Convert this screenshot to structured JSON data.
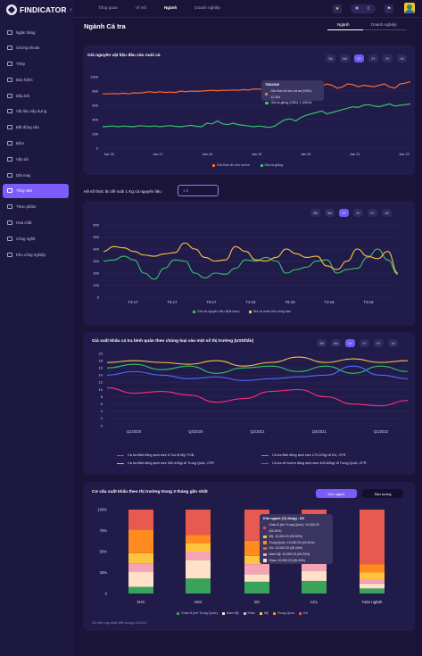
{
  "brand": {
    "name": "FINDICATOR"
  },
  "sidebar": {
    "items": [
      {
        "label": "Ngân hàng",
        "icon": "bank-icon"
      },
      {
        "label": "Chứng khoán",
        "icon": "stock-icon"
      },
      {
        "label": "Thép",
        "icon": "steel-icon"
      },
      {
        "label": "Bảo hiểm",
        "icon": "shield-icon"
      },
      {
        "label": "Dầu khí",
        "icon": "oil-icon"
      },
      {
        "label": "Vật liệu xây dựng",
        "icon": "tools-icon"
      },
      {
        "label": "Bất động sản",
        "icon": "building-icon"
      },
      {
        "label": "Điện",
        "icon": "electric-icon"
      },
      {
        "label": "Vận tải",
        "icon": "truck-icon"
      },
      {
        "label": "Dệt may",
        "icon": "textile-icon"
      },
      {
        "label": "Thủy sản",
        "icon": "fish-icon",
        "active": true
      },
      {
        "label": "Thực phẩm",
        "icon": "food-icon"
      },
      {
        "label": "Hoá chất",
        "icon": "chemical-icon"
      },
      {
        "label": "Công nghệ",
        "icon": "tech-icon"
      },
      {
        "label": "Khu công nghiệp",
        "icon": "industrial-park-icon"
      }
    ]
  },
  "topnav": {
    "tabs": [
      "Tổng quan",
      "Vĩ mô",
      "Ngành",
      "Doanh nghiệp"
    ],
    "active": "Ngành"
  },
  "page": {
    "title": "Ngành Cá tra",
    "tabs": [
      "Ngành",
      "Doanh nghiệp"
    ],
    "active_tab": "Ngành"
  },
  "colors": {
    "accent": "#7c5cfa",
    "orange": "#ff6a2c",
    "green": "#36c26b",
    "yellow": "#ffc43d",
    "pink": "#ff2f7d",
    "bg": "#1a1538",
    "card": "#211b4a"
  },
  "chart1": {
    "pills": [
      "3M",
      "6M",
      "1Y",
      "3Y",
      "5Y",
      "All"
    ],
    "active": "1Y"
  },
  "ratio": {
    "label": "Hệ số thức ăn để nuôi 1 Kg cá nguyên liệu",
    "placeholder": "1.5"
  },
  "chart2": {
    "pills": [
      "3M",
      "6M",
      "1Y",
      "3Y",
      "5Y",
      "All"
    ],
    "active": "1Y"
  },
  "chart3": {
    "pills": [
      "3M",
      "6M",
      "1Y",
      "3Y",
      "5Y",
      "All"
    ],
    "active": "1Y"
  },
  "chart4": {
    "buttons": [
      "Kim ngạch",
      "Sản lượng"
    ],
    "active": "Kim ngạch",
    "tooltip": {
      "title": "Kim ngạch (Tỷ đồng) - IDI",
      "rows": [
        {
          "label": "Châu Á (trừ Trung Quốc): 10,000.23 (45.34%)",
          "color": "#ff2f7d"
        },
        {
          "label": "Mỹ: 10,000.23 (45.34%)",
          "color": "#ffc43d"
        },
        {
          "label": "Trung Quốc: 10,000.23 (45.34%)",
          "color": "#ff8a1f"
        },
        {
          "label": "EU: 10,000.23 (45.34%)",
          "color": "#e85a4f"
        },
        {
          "label": "Nam Mỹ: 10,000.23 (45.34%)",
          "color": "#f5a3b5"
        },
        {
          "label": "Khác: 10,000.23 (45.34%)",
          "color": "#ffe0c8"
        }
      ]
    },
    "note": "Dữ liệu cập nhật đến tháng 12/2022"
  },
  "chart_data": [
    {
      "type": "line",
      "title": "Giá nguyên vật liệu đầu vào nuôi cá",
      "x_ticks": [
        "Jan 16",
        "Jan 17",
        "Jan 18",
        "Jan 19",
        "Jan 20",
        "Jan 21",
        "Jan 22"
      ],
      "ylim": [
        0,
        1000
      ],
      "y_ticks": [
        0,
        200,
        400,
        600,
        800,
        1000
      ],
      "series": [
        {
          "name": "Giá thức ăn cho cá tra",
          "color": "#ff6a2c",
          "values": [
            760,
            760,
            765,
            760,
            770,
            760,
            775,
            770,
            780,
            790,
            780,
            790,
            780,
            785,
            780,
            800,
            790,
            800,
            795,
            800,
            805,
            810,
            805,
            810,
            810,
            815,
            810,
            820,
            815,
            830,
            825,
            835,
            830,
            840,
            860,
            900,
            870,
            880,
            850,
            880,
            840,
            860,
            870,
            900,
            880,
            840,
            860,
            900,
            890,
            860,
            880,
            870,
            860,
            880,
            900,
            860,
            840,
            900,
            910,
            930
          ]
        },
        {
          "name": "Giá cá giống",
          "color": "#36c26b",
          "values": [
            300,
            305,
            310,
            300,
            310,
            305,
            300,
            315,
            310,
            305,
            310,
            300,
            310,
            315,
            305,
            300,
            310,
            320,
            305,
            300,
            350,
            340,
            380,
            340,
            330,
            350,
            330,
            320,
            310,
            300,
            310,
            300,
            290,
            310,
            360,
            400,
            410,
            380,
            430,
            460,
            480,
            500,
            520,
            480,
            500,
            520,
            540,
            560,
            580,
            570,
            600,
            610,
            590,
            580,
            600,
            620,
            590,
            600,
            610,
            620
          ]
        }
      ],
      "tooltip": {
        "title": "T08/2020",
        "rows": [
          "Giá thức ăn cho cá tra (VND): 12,304",
          "Giá cá giống (VND): 1,205.04"
        ]
      }
    },
    {
      "type": "line",
      "x_ticks": [
        "T3-17",
        "T6-17",
        "T9-17",
        "T3-19",
        "T6-19",
        "T3-19",
        "T3-19"
      ],
      "ylim": [
        0,
        600
      ],
      "y_ticks": [
        0,
        100,
        200,
        300,
        400,
        500,
        600
      ],
      "series": [
        {
          "name": "Giá cá nguyên liệu (Đài loan)",
          "color": "#36c26b",
          "values": [
            300,
            310,
            340,
            310,
            200,
            150,
            240,
            310,
            300,
            200,
            160,
            200,
            190,
            240,
            310,
            300,
            330,
            300,
            200,
            230,
            250,
            300,
            310,
            200,
            230,
            240,
            330,
            400,
            310,
            190
          ]
        },
        {
          "name": "Giá cá xuất cửa nông dân",
          "color": "#ffc43d",
          "values": [
            380,
            420,
            410,
            380,
            350,
            340,
            360,
            370,
            450,
            400,
            330,
            300,
            310,
            420,
            380,
            310,
            300,
            330,
            400,
            360,
            330,
            340,
            260,
            230,
            300,
            400,
            340,
            320,
            380,
            200
          ]
        }
      ]
    },
    {
      "type": "line",
      "title": "Giá xuất khẩu cá tra bình quân theo chủng loại vào một số thị trường (USD/tấn)",
      "x_ticks": [
        "Q1/2020",
        "Q4/2020",
        "Q1/2021",
        "Q4/2021",
        "Q1/2022"
      ],
      "ylim": [
        0,
        20
      ],
      "y_ticks": [
        0,
        2,
        4,
        6,
        8,
        10,
        12,
        14,
        16,
        18,
        20
      ],
      "series": [
        {
          "name": "Cá tra fillet đông lạnh size 5-7oz đi Mỹ, FOB",
          "color": "#ff2f7d",
          "values": [
            10.5,
            9,
            9.5,
            8.5,
            6.5,
            7.5,
            9.5,
            10,
            8,
            6,
            5.5,
            7
          ]
        },
        {
          "name": "Cá tra fillet đông lạnh size 170-220gr đi EU, CFR",
          "color": "#36c26b",
          "values": [
            16,
            17,
            15.5,
            16.5,
            14.5,
            16,
            16.5,
            15,
            16.5,
            14.5,
            16.5,
            15
          ]
        },
        {
          "name": "Cá tra fillet đông lạnh size 300-400gr đi Trung Quốc, CFR",
          "color": "#ffc43d",
          "values": [
            17.5,
            18,
            17.5,
            17,
            18,
            16.5,
            17.5,
            19,
            17.5,
            18.5,
            17.5,
            18
          ]
        },
        {
          "name": "Cá tra xẻ bướm đông lạnh size 400-600gr đi Trung Quốc, CFR",
          "color": "#4e6cff",
          "values": [
            14,
            15,
            14,
            13,
            13.5,
            12.5,
            13,
            13.5,
            14,
            16.5,
            14,
            13
          ]
        }
      ]
    },
    {
      "type": "bar",
      "stacked": true,
      "title": "Cơ cấu xuất khẩu theo thị trường trong 3 tháng gần nhất",
      "categories": [
        "VHC",
        "ANV",
        "IDI",
        "ACL",
        "Toàn ngành"
      ],
      "y_ticks": [
        "0",
        "25%",
        "50%",
        "75%",
        "100%"
      ],
      "series": [
        {
          "name": "Châu Á (trừ Trung Quốc)",
          "color": "#3aa35a",
          "values": [
            8,
            18,
            14,
            15,
            6
          ]
        },
        {
          "name": "Nam Mỹ",
          "color": "#ffe0c8",
          "values": [
            18,
            22,
            9,
            12,
            6
          ]
        },
        {
          "name": "Khác",
          "color": "#f5a3b5",
          "values": [
            10,
            10,
            12,
            12,
            5
          ]
        },
        {
          "name": "Mỹ",
          "color": "#ffc43d",
          "values": [
            12,
            10,
            10,
            22,
            8
          ]
        },
        {
          "name": "Trung Quốc",
          "color": "#ff8a1f",
          "values": [
            28,
            10,
            18,
            10,
            10
          ]
        },
        {
          "name": "EU",
          "color": "#e85a4f",
          "values": [
            24,
            30,
            37,
            29,
            65
          ]
        }
      ]
    }
  ]
}
